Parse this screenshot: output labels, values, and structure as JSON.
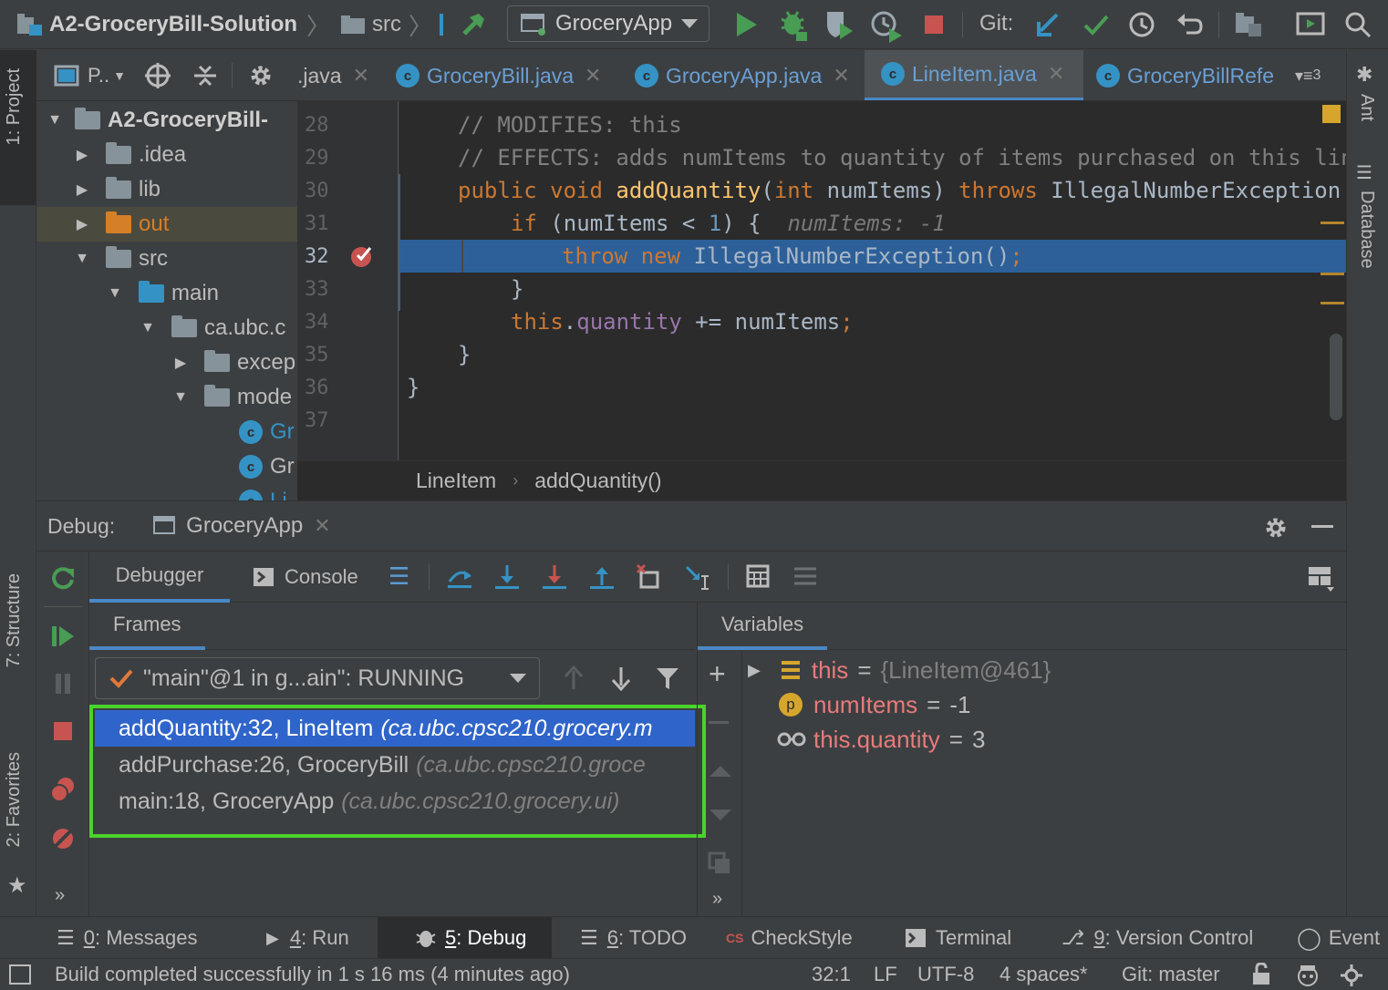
{
  "toolbar": {
    "project": "A2-GroceryBill-Solution",
    "src": "src",
    "run_config": "GroceryApp",
    "git_label": "Git:"
  },
  "left_stripe": {
    "project_tab": "1: Project",
    "structure_tab": "7: Structure",
    "favorites_tab": "2: Favorites"
  },
  "right_stripe": {
    "ant_tab": "Ant",
    "database_tab": "Database"
  },
  "project": {
    "view_label": "P..",
    "tree": [
      {
        "label": "A2-GroceryBill-",
        "kind": "project",
        "expanded": true
      },
      {
        "label": ".idea",
        "kind": "folder"
      },
      {
        "label": "lib",
        "kind": "folder"
      },
      {
        "label": "out",
        "kind": "excluded"
      },
      {
        "label": "src",
        "kind": "folder",
        "expanded": true
      },
      {
        "label": "main",
        "kind": "source",
        "expanded": true
      },
      {
        "label": "ca.ubc.c",
        "kind": "package",
        "expanded": true
      },
      {
        "label": "excep",
        "kind": "package"
      },
      {
        "label": "mode",
        "kind": "package",
        "expanded": true
      },
      {
        "label": "Gr",
        "kind": "class"
      },
      {
        "label": "Gr",
        "kind": "class"
      },
      {
        "label": "Li",
        "kind": "class"
      }
    ]
  },
  "tabs": [
    {
      "label": ".java"
    },
    {
      "label": "GroceryBill.java"
    },
    {
      "label": "GroceryApp.java"
    },
    {
      "label": "LineItem.java",
      "active": true
    },
    {
      "label": "GroceryBillRefe"
    }
  ],
  "tabs_overflow": "3",
  "editor": {
    "lines": [
      {
        "num": "28",
        "text": "// MODIFIES: this"
      },
      {
        "num": "29",
        "text": "// EFFECTS: adds numItems to quantity of items purchased on this line"
      },
      {
        "num": "30",
        "kw1": "public",
        "kw2": "void",
        "fn": "addQuantity",
        "p1": "(",
        "kw3": "int",
        "p2": " numItems) ",
        "kw4": "throws",
        "p3": " IllegalNumberException {"
      },
      {
        "num": "31",
        "kw": "if",
        "text": " (numItems < ",
        "num_lit": "1",
        "text2": ") {",
        "hint": "numItems: -1"
      },
      {
        "num": "32",
        "kw1": "throw",
        "kw2": "new",
        "text": "IllegalNumberException()",
        "semi": ";"
      },
      {
        "num": "33",
        "text": "}"
      },
      {
        "num": "34",
        "kw": "this",
        "dot": ".",
        "field": "quantity",
        "text": " += numItems",
        "semi": ";"
      },
      {
        "num": "35",
        "text": "}"
      },
      {
        "num": "36",
        "text": "}"
      },
      {
        "num": "37",
        "text": ""
      }
    ],
    "breadcrumb": [
      "LineItem",
      "addQuantity()"
    ]
  },
  "debug": {
    "label": "Debug:",
    "session": "GroceryApp",
    "tabs": {
      "debugger": "Debugger",
      "console": "Console"
    },
    "frames_title": "Frames",
    "variables_title": "Variables",
    "thread": "\"main\"@1 in g...ain\": RUNNING",
    "frames": [
      {
        "method": "addQuantity:32, LineItem",
        "pkg": "(ca.ubc.cpsc210.grocery.m",
        "selected": true
      },
      {
        "method": "addPurchase:26, GroceryBill",
        "pkg": "(ca.ubc.cpsc210.groce"
      },
      {
        "method": "main:18, GroceryApp",
        "pkg": "(ca.ubc.cpsc210.grocery.ui)"
      }
    ],
    "variables": [
      {
        "name": "this",
        "value": "{LineItem@461}",
        "icon": "field-icon",
        "expandable": true
      },
      {
        "name": "numItems",
        "value": "-1",
        "icon": "param-icon"
      },
      {
        "name": "this.quantity",
        "value": "3",
        "icon": "watch-icon"
      }
    ]
  },
  "bottom_tools": [
    {
      "num": "0",
      "label": ": Messages"
    },
    {
      "num": "4",
      "label": ": Run"
    },
    {
      "num": "5",
      "label": ": Debug",
      "active": true
    },
    {
      "num": "6",
      "label": ": TODO"
    },
    {
      "num": "",
      "label": "CheckStyle"
    },
    {
      "num": "",
      "label": "Terminal"
    },
    {
      "num": "9",
      "label": ": Version Control"
    },
    {
      "num": "",
      "label": "Event"
    }
  ],
  "status": {
    "message": "Build completed successfully in 1 s 16 ms (4 minutes ago)",
    "position": "32:1",
    "line_sep": "LF",
    "encoding": "UTF-8",
    "indent": "4 spaces*",
    "git": "Git: master"
  },
  "colors": {
    "accent": "#4a88c7",
    "selection": "#2f65ca",
    "highlight_box": "#4bd32b",
    "exec_line": "#2d6099",
    "run_green": "#499c54",
    "stop_red": "#c75450"
  }
}
